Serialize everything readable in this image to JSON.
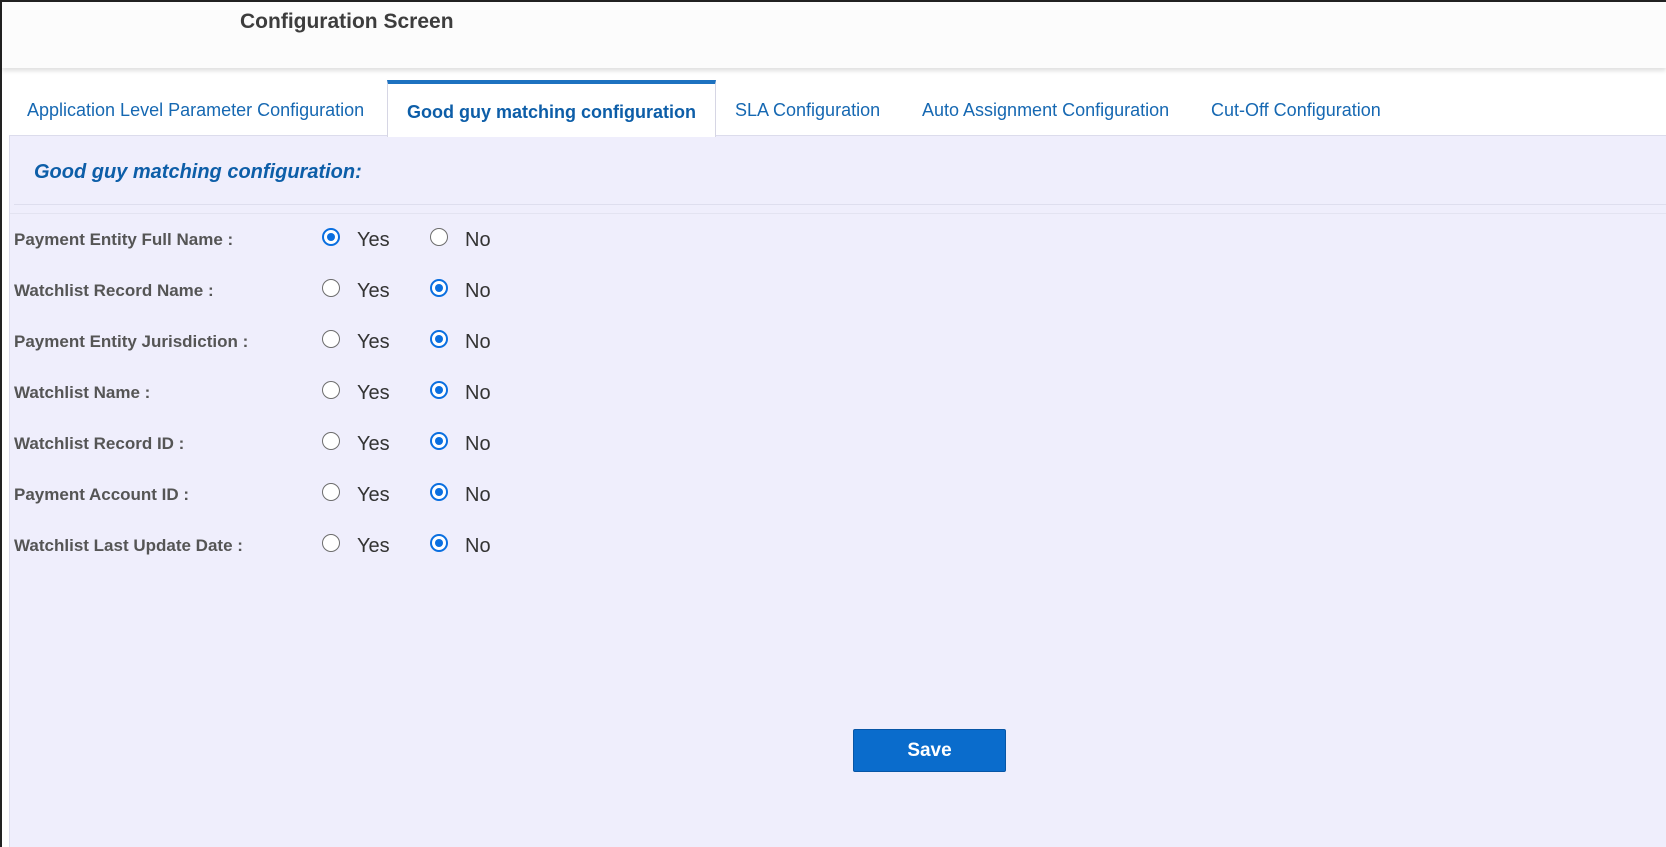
{
  "header": {
    "title": "Configuration Screen"
  },
  "tabs": [
    {
      "label": "Application Level Parameter Configuration",
      "active": false
    },
    {
      "label": "Good guy matching configuration",
      "active": true
    },
    {
      "label": "SLA Configuration",
      "active": false
    },
    {
      "label": "Auto Assignment Configuration",
      "active": false
    },
    {
      "label": "Cut-Off Configuration",
      "active": false
    }
  ],
  "section": {
    "title": "Good guy matching configuration:"
  },
  "options": [
    {
      "label": "Payment Entity Full Name :",
      "yes_label": "Yes",
      "no_label": "No",
      "selected": "Yes"
    },
    {
      "label": "Watchlist Record Name :",
      "yes_label": "Yes",
      "no_label": "No",
      "selected": "No"
    },
    {
      "label": "Payment Entity Jurisdiction :",
      "yes_label": "Yes",
      "no_label": "No",
      "selected": "No"
    },
    {
      "label": "Watchlist Name :",
      "yes_label": "Yes",
      "no_label": "No",
      "selected": "No"
    },
    {
      "label": "Watchlist Record ID :",
      "yes_label": "Yes",
      "no_label": "No",
      "selected": "No"
    },
    {
      "label": "Payment Account ID :",
      "yes_label": "Yes",
      "no_label": "No",
      "selected": "No"
    },
    {
      "label": "Watchlist Last Update Date :",
      "yes_label": "Yes",
      "no_label": "No",
      "selected": "No"
    }
  ],
  "actions": {
    "save_label": "Save"
  },
  "colors": {
    "accent": "#0a6ccc",
    "panel_background": "#efeefc",
    "tab_text": "#1668b2"
  }
}
